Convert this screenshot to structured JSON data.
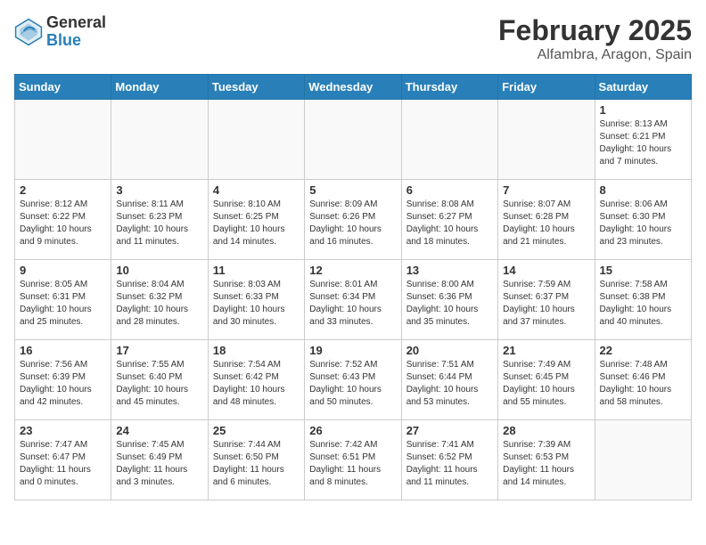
{
  "header": {
    "logo_general": "General",
    "logo_blue": "Blue",
    "title": "February 2025",
    "location": "Alfambra, Aragon, Spain"
  },
  "weekdays": [
    "Sunday",
    "Monday",
    "Tuesday",
    "Wednesday",
    "Thursday",
    "Friday",
    "Saturday"
  ],
  "weeks": [
    [
      {
        "day": "",
        "empty": true
      },
      {
        "day": "",
        "empty": true
      },
      {
        "day": "",
        "empty": true
      },
      {
        "day": "",
        "empty": true
      },
      {
        "day": "",
        "empty": true
      },
      {
        "day": "",
        "empty": true
      },
      {
        "day": "1",
        "sunrise": "8:13 AM",
        "sunset": "6:21 PM",
        "daylight": "10 hours and 7 minutes."
      }
    ],
    [
      {
        "day": "2",
        "sunrise": "8:12 AM",
        "sunset": "6:22 PM",
        "daylight": "10 hours and 9 minutes."
      },
      {
        "day": "3",
        "sunrise": "8:11 AM",
        "sunset": "6:23 PM",
        "daylight": "10 hours and 11 minutes."
      },
      {
        "day": "4",
        "sunrise": "8:10 AM",
        "sunset": "6:25 PM",
        "daylight": "10 hours and 14 minutes."
      },
      {
        "day": "5",
        "sunrise": "8:09 AM",
        "sunset": "6:26 PM",
        "daylight": "10 hours and 16 minutes."
      },
      {
        "day": "6",
        "sunrise": "8:08 AM",
        "sunset": "6:27 PM",
        "daylight": "10 hours and 18 minutes."
      },
      {
        "day": "7",
        "sunrise": "8:07 AM",
        "sunset": "6:28 PM",
        "daylight": "10 hours and 21 minutes."
      },
      {
        "day": "8",
        "sunrise": "8:06 AM",
        "sunset": "6:30 PM",
        "daylight": "10 hours and 23 minutes."
      }
    ],
    [
      {
        "day": "9",
        "sunrise": "8:05 AM",
        "sunset": "6:31 PM",
        "daylight": "10 hours and 25 minutes."
      },
      {
        "day": "10",
        "sunrise": "8:04 AM",
        "sunset": "6:32 PM",
        "daylight": "10 hours and 28 minutes."
      },
      {
        "day": "11",
        "sunrise": "8:03 AM",
        "sunset": "6:33 PM",
        "daylight": "10 hours and 30 minutes."
      },
      {
        "day": "12",
        "sunrise": "8:01 AM",
        "sunset": "6:34 PM",
        "daylight": "10 hours and 33 minutes."
      },
      {
        "day": "13",
        "sunrise": "8:00 AM",
        "sunset": "6:36 PM",
        "daylight": "10 hours and 35 minutes."
      },
      {
        "day": "14",
        "sunrise": "7:59 AM",
        "sunset": "6:37 PM",
        "daylight": "10 hours and 37 minutes."
      },
      {
        "day": "15",
        "sunrise": "7:58 AM",
        "sunset": "6:38 PM",
        "daylight": "10 hours and 40 minutes."
      }
    ],
    [
      {
        "day": "16",
        "sunrise": "7:56 AM",
        "sunset": "6:39 PM",
        "daylight": "10 hours and 42 minutes."
      },
      {
        "day": "17",
        "sunrise": "7:55 AM",
        "sunset": "6:40 PM",
        "daylight": "10 hours and 45 minutes."
      },
      {
        "day": "18",
        "sunrise": "7:54 AM",
        "sunset": "6:42 PM",
        "daylight": "10 hours and 48 minutes."
      },
      {
        "day": "19",
        "sunrise": "7:52 AM",
        "sunset": "6:43 PM",
        "daylight": "10 hours and 50 minutes."
      },
      {
        "day": "20",
        "sunrise": "7:51 AM",
        "sunset": "6:44 PM",
        "daylight": "10 hours and 53 minutes."
      },
      {
        "day": "21",
        "sunrise": "7:49 AM",
        "sunset": "6:45 PM",
        "daylight": "10 hours and 55 minutes."
      },
      {
        "day": "22",
        "sunrise": "7:48 AM",
        "sunset": "6:46 PM",
        "daylight": "10 hours and 58 minutes."
      }
    ],
    [
      {
        "day": "23",
        "sunrise": "7:47 AM",
        "sunset": "6:47 PM",
        "daylight": "11 hours and 0 minutes."
      },
      {
        "day": "24",
        "sunrise": "7:45 AM",
        "sunset": "6:49 PM",
        "daylight": "11 hours and 3 minutes."
      },
      {
        "day": "25",
        "sunrise": "7:44 AM",
        "sunset": "6:50 PM",
        "daylight": "11 hours and 6 minutes."
      },
      {
        "day": "26",
        "sunrise": "7:42 AM",
        "sunset": "6:51 PM",
        "daylight": "11 hours and 8 minutes."
      },
      {
        "day": "27",
        "sunrise": "7:41 AM",
        "sunset": "6:52 PM",
        "daylight": "11 hours and 11 minutes."
      },
      {
        "day": "28",
        "sunrise": "7:39 AM",
        "sunset": "6:53 PM",
        "daylight": "11 hours and 14 minutes."
      },
      {
        "day": "",
        "empty": true
      }
    ]
  ]
}
